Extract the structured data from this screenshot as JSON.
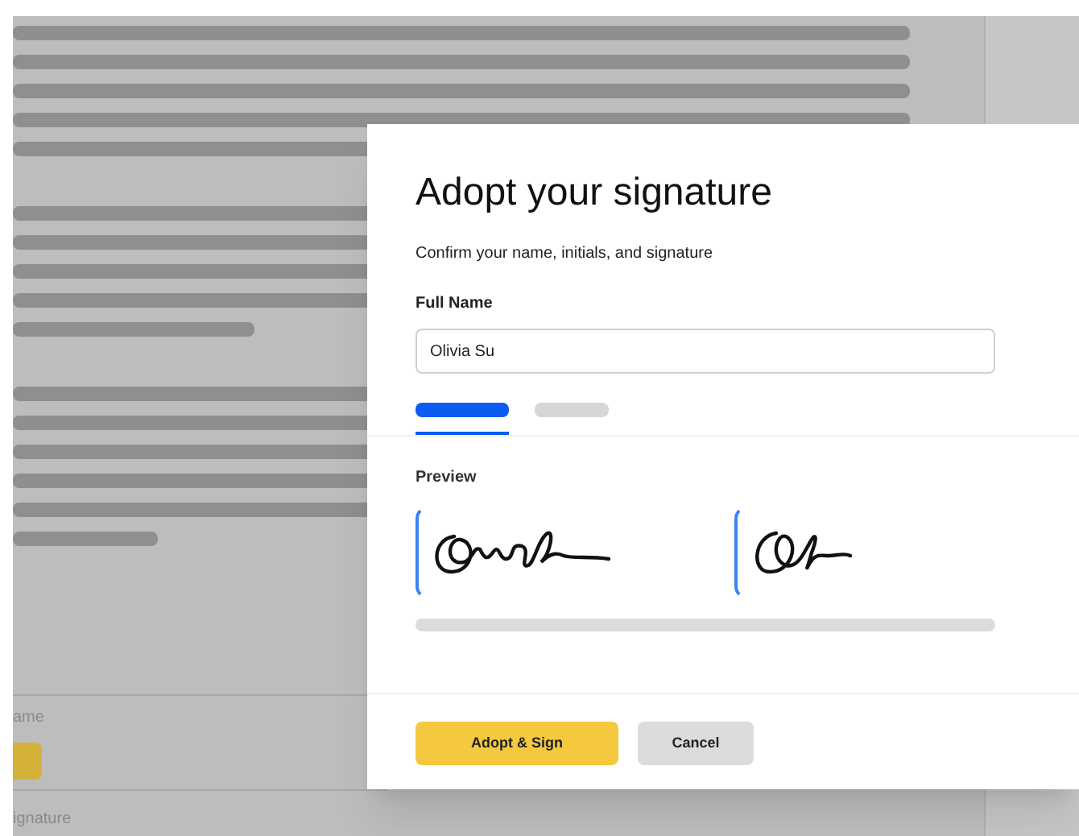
{
  "background_form": {
    "field_1_label": "ame",
    "field_2_label": "ignature"
  },
  "dialog": {
    "title": "Adopt your signature",
    "subtitle": "Confirm your name, initials, and signature",
    "full_name": {
      "label": "Full Name",
      "value": "Olivia Su"
    },
    "tabs": [
      {
        "selected": true
      },
      {
        "selected": false
      }
    ],
    "preview_label": "Preview",
    "buttons": [
      {
        "label": "Adopt & Sign",
        "kind": "primary"
      },
      {
        "label": "Cancel",
        "kind": "secondary"
      }
    ]
  }
}
